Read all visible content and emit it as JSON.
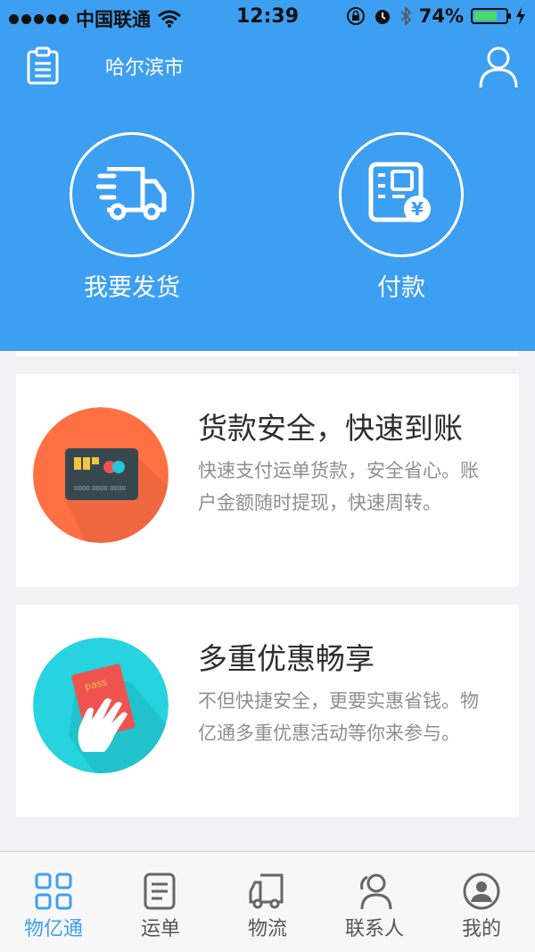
{
  "status_bar": {
    "carrier": "中国联通",
    "time": "12:39",
    "battery": "74%",
    "battery_level": 0.74
  },
  "header": {
    "city": "哈尔滨市",
    "left_icon": "orders-list-icon",
    "right_icon": "user-icon"
  },
  "actions": [
    {
      "label": "我要发货",
      "icon": "truck-icon"
    },
    {
      "label": "付款",
      "icon": "bill-yuan-icon"
    }
  ],
  "cards": [
    {
      "title": "货款安全，快速到账",
      "description": "快速支付运单货款，安全省心。账户金额随时提现，快速周转。",
      "icon": "bank-card-icon",
      "circle_color": "#ff7043"
    },
    {
      "title": "多重优惠畅享",
      "description": "不但快捷安全，更要实惠省钱。物亿通多重优惠活动等你来参与。",
      "icon": "hand-pass-icon",
      "circle_color": "#26d3de"
    }
  ],
  "tabbar": {
    "tabs": [
      {
        "label": "物亿通",
        "icon": "grid-icon",
        "active": true
      },
      {
        "label": "运单",
        "icon": "waybill-icon",
        "active": false
      },
      {
        "label": "物流",
        "icon": "logistics-truck-icon",
        "active": false
      },
      {
        "label": "联系人",
        "icon": "contacts-icon",
        "active": false
      },
      {
        "label": "我的",
        "icon": "profile-icon",
        "active": false
      }
    ]
  },
  "colors": {
    "primary": "#3d9ff1",
    "orange": "#ff7043",
    "teal": "#26d3de"
  }
}
